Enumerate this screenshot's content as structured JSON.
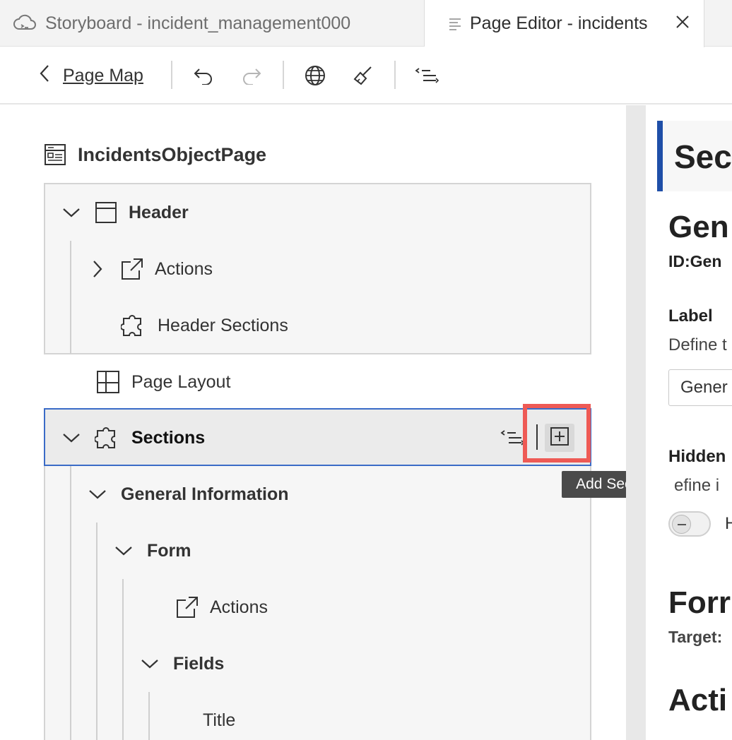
{
  "tabs": [
    {
      "label": "Storyboard - incident_management000",
      "icon": "cloud-icon",
      "active": false
    },
    {
      "label": "Page Editor - incidents",
      "icon": "document-lines-icon",
      "active": true,
      "close_icon": "close-icon"
    }
  ],
  "toolbar": {
    "back_label": "Page Map",
    "icons": [
      "undo-icon",
      "redo-icon",
      "globe-icon",
      "broom-icon",
      "outline-icon"
    ]
  },
  "tree": {
    "page_title": "IncidentsObjectPage",
    "header": {
      "label": "Header",
      "children": [
        {
          "label": "Actions",
          "icon": "external-link-icon",
          "expandable": true
        },
        {
          "label": "Header Sections",
          "icon": "puzzle-icon",
          "expandable": false
        }
      ]
    },
    "page_layout_label": "Page Layout",
    "sections": {
      "label": "Sections",
      "add_tooltip": "Add Sections",
      "children": [
        {
          "label": "General Information"
        },
        {
          "label": "Form"
        },
        {
          "label": "Actions"
        },
        {
          "label": "Fields"
        },
        {
          "label": "Title"
        }
      ]
    }
  },
  "properties": {
    "heading": "Sec",
    "section_title": "Gen",
    "id_label": "ID:",
    "id_value": "Gen",
    "label_field_title": "Label",
    "label_field_desc": "Define t",
    "label_input_value": "Gener",
    "hidden_title": "Hidden",
    "hidden_desc": "efine i",
    "toggle_label": "H",
    "form_title": "Forr",
    "target_label": "Target:",
    "actions_title": "Acti"
  },
  "colors": {
    "accent_blue": "#1f4fa8",
    "selection_border": "#3a6bc7",
    "highlight_red": "#ee5a55"
  }
}
